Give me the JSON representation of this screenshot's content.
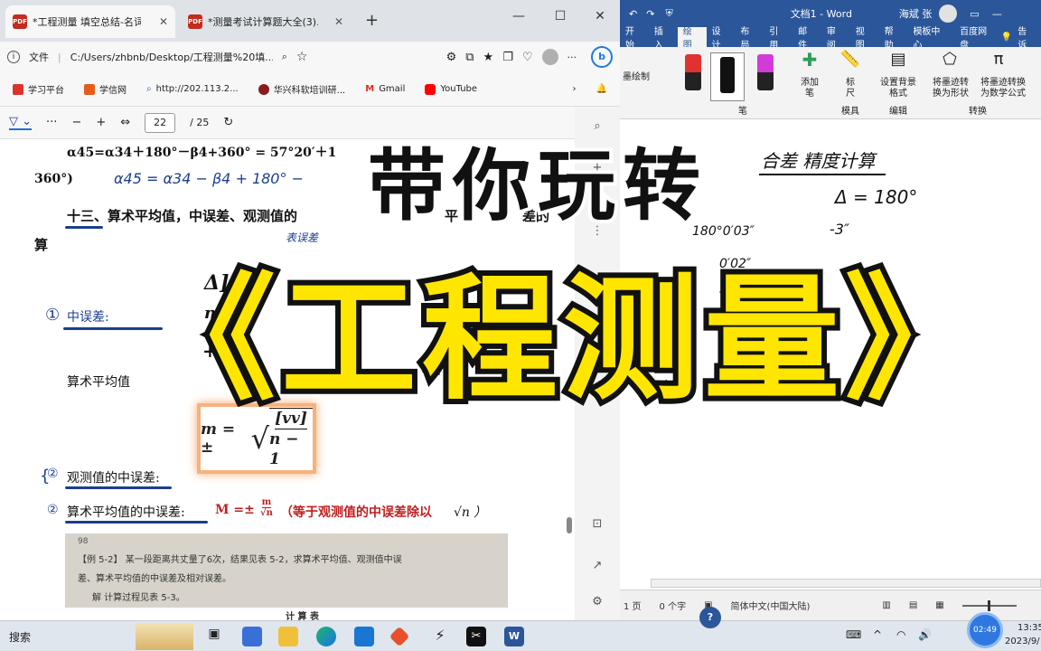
{
  "browser": {
    "tabs": [
      {
        "title": "*工程测量 填空总结-名词解释"
      },
      {
        "title": "*测量考试计算题大全(3).pdf"
      }
    ],
    "new_tab": "+",
    "file_label": "文件",
    "url": "C:/Users/zhbnb/Desktop/工程测量%20填...",
    "favorites": [
      "学习平台",
      "学信网",
      "http://202.113.2...",
      "华兴科软培训研...",
      "Gmail",
      "YouTube"
    ],
    "pdf_toolbar": {
      "more": "···",
      "minus": "−",
      "plus": "+",
      "page": "22",
      "total": "/ 25"
    }
  },
  "pdf": {
    "line1": "α45=α34＋180°－β4+360° = 57°20′＋1",
    "line1_hand": "α45 = α34 − β4 + 180° −",
    "line2": "360°)",
    "heading": "十三、算术平均值，中误差、观测值的",
    "heading_tail": "平",
    "heading_end": "差的",
    "heading_cont": "算",
    "note_hand": "表误差",
    "frac_top": "Δ]",
    "frac_n": "n",
    "item1_num": "①",
    "item1": "中误差:",
    "item1_expr": "+l",
    "avg_label": "算术平均值",
    "formula_m": "m = ±",
    "formula_num": "[vv]",
    "formula_den": "n − 1",
    "item2_num": "②",
    "item2": "观测值的中误差:",
    "item3_num": "②",
    "item3": "算术平均值的中误差:",
    "item3_formula": "M =±",
    "item3_frac_top": "m",
    "item3_frac_bot": "√n",
    "item3_note": "（等于观测值的中误差除以",
    "item3_note_end": "√n ）",
    "scan_pagenum": "98",
    "scan_line1": "【例 5-2】  某一段距离共丈量了6次，结果见表 5-2，求算术平均值、观测值中误",
    "scan_line2": "差、算术平均值的中误差及相对误差。",
    "scan_line3": "解   计算过程见表 5-3。",
    "scan_line4": "计  算  表"
  },
  "word": {
    "title": "文档1 - Word",
    "user": "海斌 张",
    "tabs": [
      "开始",
      "插入",
      "绘图",
      "设计",
      "布局",
      "引用",
      "邮件",
      "审阅",
      "视图",
      "帮助",
      "模板中心",
      "百度网盘",
      "告诉"
    ],
    "active_tab": "绘图",
    "ribbon": {
      "draw_label": "墨绘制",
      "add_pen": "添加\n笔",
      "pen_group": "笔",
      "ruler": "标\n尺",
      "ruler_group": "模具",
      "bg": "设置背景\n格式",
      "edit_group": "编辑",
      "ink_shape": "将墨迹转\n换为形状",
      "ink_math": "将墨迹转换\n为数学公式",
      "convert_group": "转换"
    },
    "ink": {
      "title": "合差 精度计算",
      "delta": "Δ = 180°",
      "minus3": "-3″",
      "v1": "180°0′03″",
      "v2": "0′02″",
      "v3": "5″0″"
    },
    "status": {
      "page": "1 页",
      "words": "0 个字",
      "lang": "简体中文(中国大陆)"
    }
  },
  "taskbar": {
    "search": "搜索",
    "time": "13:35",
    "date": "2023/9/",
    "clock_badge": "02:49"
  },
  "overlay": {
    "line1": "带你玩转",
    "line2": "《工程测量》"
  },
  "colors": {
    "word_blue": "#2b579a",
    "overlay_yellow": "#ffe600",
    "edge_blue": "#0078d4"
  }
}
